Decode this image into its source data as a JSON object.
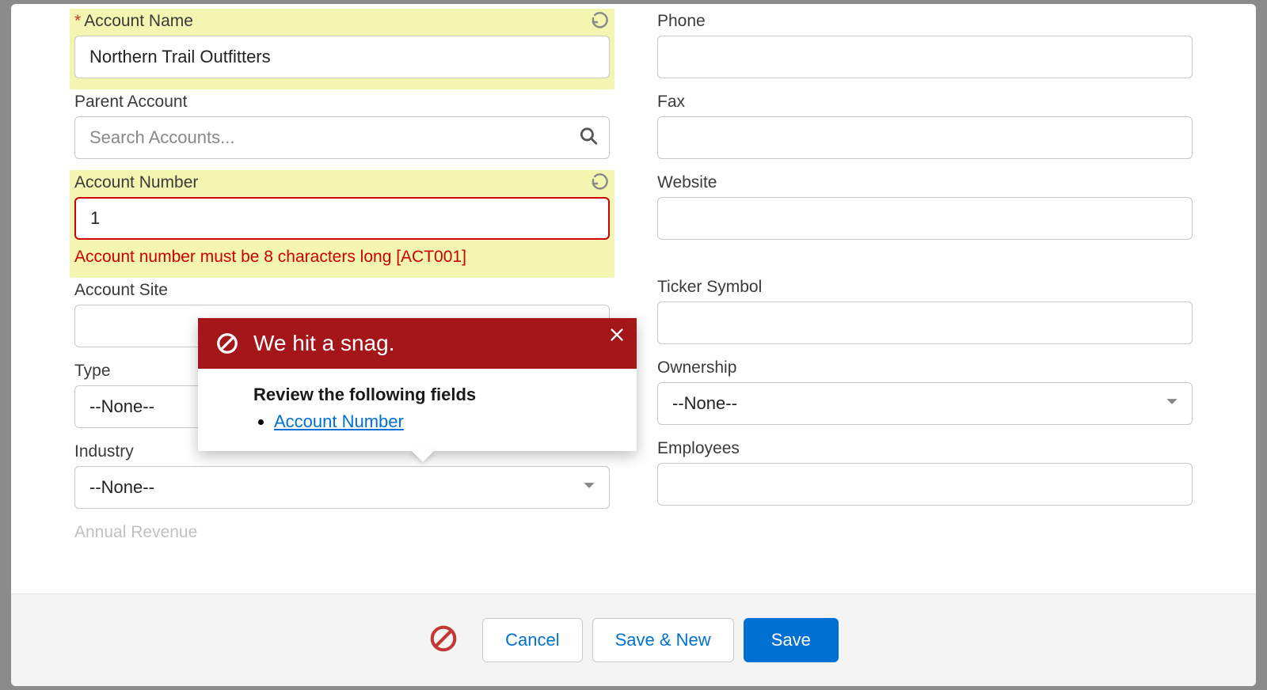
{
  "fields": {
    "account_name": {
      "label": "Account Name",
      "value": "Northern Trail Outfitters",
      "required": true,
      "highlighted": true
    },
    "parent_account": {
      "label": "Parent Account",
      "placeholder": "Search Accounts..."
    },
    "account_number": {
      "label": "Account Number",
      "value": "1",
      "highlighted": true,
      "error": "Account number must be 8 characters long [ACT001]"
    },
    "account_site": {
      "label": "Account Site",
      "value": ""
    },
    "type": {
      "label": "Type",
      "value": "--None--"
    },
    "industry": {
      "label": "Industry",
      "value": "--None--"
    },
    "annual_revenue": {
      "label": "Annual Revenue"
    },
    "phone": {
      "label": "Phone",
      "value": ""
    },
    "fax": {
      "label": "Fax",
      "value": ""
    },
    "website": {
      "label": "Website",
      "value": ""
    },
    "ticker_symbol": {
      "label": "Ticker Symbol",
      "value": ""
    },
    "ownership": {
      "label": "Ownership",
      "value": "--None--"
    },
    "employees": {
      "label": "Employees",
      "value": ""
    }
  },
  "popover": {
    "title": "We hit a snag.",
    "subhead": "Review the following fields",
    "links": [
      "Account Number"
    ]
  },
  "footer": {
    "cancel": "Cancel",
    "save_new": "Save & New",
    "save": "Save"
  }
}
